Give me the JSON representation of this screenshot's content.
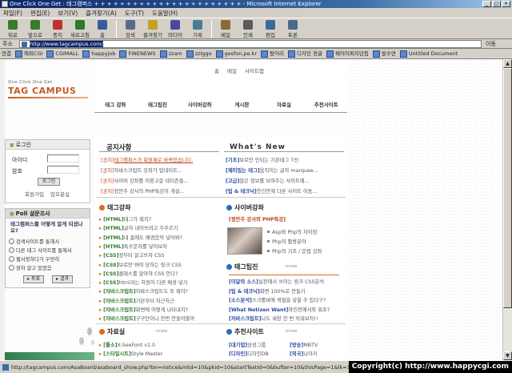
{
  "window": {
    "title": "One Click One Get : 태그캠퍼스 + + + + + + + + + + + + + + + + + + + + + + + - Microsoft Internet Explorer"
  },
  "menu": [
    "파일(F)",
    "편집(E)",
    "보기(V)",
    "즐겨찾기(A)",
    "도구(T)",
    "도움말(H)"
  ],
  "toolbar": [
    {
      "label": "뒤로",
      "icon": "back-arrow-icon",
      "color": "#3a7a2a"
    },
    {
      "label": "앞으로",
      "icon": "forward-arrow-icon",
      "color": "#3a7a2a"
    },
    {
      "label": "중지",
      "icon": "stop-icon",
      "color": "#c03030"
    },
    {
      "label": "새로고침",
      "icon": "refresh-icon",
      "color": "#2a7a2a"
    },
    {
      "label": "홈",
      "icon": "home-icon",
      "color": "#3a5aa0"
    },
    {
      "label": "검색",
      "icon": "search-icon",
      "color": "#5a6a8a"
    },
    {
      "label": "즐겨찾기",
      "icon": "favorites-icon",
      "color": "#c8a020"
    },
    {
      "label": "미디어",
      "icon": "media-icon",
      "color": "#4a4a9a"
    },
    {
      "label": "기록",
      "icon": "history-icon",
      "color": "#4a7a9a"
    },
    {
      "label": "메일",
      "icon": "mail-icon",
      "color": "#8a6a3a"
    },
    {
      "label": "인쇄",
      "icon": "print-icon",
      "color": "#5a5a5a"
    },
    {
      "label": "편집",
      "icon": "edit-icon",
      "color": "#3a6a9a"
    },
    {
      "label": "토론",
      "icon": "discuss-icon",
      "color": "#4a6a8a"
    }
  ],
  "address": {
    "label": "주소(D)",
    "url": "http://www.tagcampus.com/",
    "go": "이동"
  },
  "links": {
    "label": "연결",
    "items": [
      "해피CGI",
      "CGIMALL",
      "happyjob",
      "FINENEWS",
      "zzam",
      "zzlggo",
      "gesfon,pe.kr",
      "탐어리",
      "디자인 정글",
      "쉐어어퍼지던킴",
      "원수연",
      "Untitled Document"
    ]
  },
  "site": {
    "logo_small": "One Click One Get",
    "logo": "TAG CAMPUS",
    "toplinks": [
      "홈",
      "메일",
      "사이트맵"
    ],
    "nav": [
      "태그 강좌",
      "태그팁진",
      "사이버강좌",
      "게시판",
      "자료실",
      "추천사이트"
    ]
  },
  "login": {
    "title": "로그인",
    "id_label": "아이디",
    "pw_label": "암호",
    "login_btn": "로그인",
    "join": "회원가입",
    "find_pw": "암호분실"
  },
  "poll": {
    "title": "Poll 설문조사",
    "question": "태그캠퍼스를 어떻게 알게 되셨나요?",
    "options": [
      "검색사이트를 통해서",
      "다른 태그 사이트를 통해서",
      "웹서핑하다가 우연히",
      "원하 알고 있었음"
    ],
    "vote": "투표",
    "result": "결과"
  },
  "notice": {
    "title": "공지사항",
    "items": [
      {
        "tag": "[공지]",
        "text": "태그캠퍼스가 회원제로 바뀌었습니다.",
        "hl": true
      },
      {
        "tag": "[공지]",
        "text": "자바스크립트 강좌가 업데이트..."
      },
      {
        "tag": "[공지]",
        "text": "사이버 강좌를 이용고갈 네티즌들..."
      },
      {
        "tag": "[공지]",
        "text": "정안주 강사의 PHP특강이 개설..."
      }
    ]
  },
  "whatsnew": {
    "title": "What's New",
    "items": [
      {
        "tag": "[기초]",
        "text": "보로만 인되는 기본태그 7선"
      },
      {
        "tag": "[재미있는 태그]",
        "text": "움직이는 글자 marquee..."
      },
      {
        "tag": "[고급]",
        "text": "많은 정보를 보여주는 사이트에..."
      },
      {
        "tag": "[팁 & 테크닉]",
        "text": "웃긴만해 다른 사이트 이동..."
      }
    ]
  },
  "tag_lecture": {
    "title": "태그강좌",
    "items": [
      {
        "tag": "[HTML]",
        "text": "태그가 뭐지?"
      },
      {
        "tag": "[HTML]",
        "text": "글자 내어쓰려고 주무르기"
      },
      {
        "tag": "[HTML]",
        "text": "내 홈에도 배경음악 넣어봐?"
      },
      {
        "tag": "[HTML]",
        "text": "특수문자를 넣어보자"
      },
      {
        "tag": "[CSS]",
        "text": "정부터 알고쓰자 CSS"
      },
      {
        "tag": "[CSS]",
        "text": "보로만 봐야 당하는 링크 CSS"
      },
      {
        "tag": "[CSS]",
        "text": "클래스를 알아야 CSS 안다?"
      },
      {
        "tag": "[CSS]",
        "text": "html과는 차원이 다른 배경 넣기"
      },
      {
        "tag": "[자바스크립트]",
        "text": "자바스크립트도 또 뭐야?"
      },
      {
        "tag": "[자바스크립트]",
        "text": "기본부터 차근차근"
      },
      {
        "tag": "[자바스크립트]",
        "text": "화면에 어떻게 나타내지?"
      },
      {
        "tag": "[자바스크립트]",
        "text": "구구단이나 한번 만들어볼까"
      }
    ]
  },
  "cyber": {
    "title": "사이버강좌",
    "headline": "[정안주 강사의 PHP특강]",
    "items": [
      "Asp와 Php의 차이점",
      "Php의 활용분야",
      "Php의 기초 / 문법 강좌"
    ]
  },
  "tagtip": {
    "title": "태그팁진",
    "more": "more",
    "items": [
      {
        "tag": "[이달의 소스]",
        "text": "실전에서 쓰이는 링크 CSS분석"
      },
      {
        "tag": "[팁 & 테크닉]",
        "text": "화면 100%로 만들기"
      },
      {
        "tag": "[소스분석]",
        "text": "스크롤바에 색칠을 넣을 수 있다구?"
      },
      {
        "tag": "[What Netizen Want]",
        "text": "마인전에서와 워죠?"
      },
      {
        "tag": "[자바스크립트]",
        "text": "나도 새창 한 번 띄워보자!!"
      }
    ]
  },
  "pds": {
    "title": "자료실",
    "more": "more",
    "items": [
      {
        "tag": "[툴소]",
        "text": "X-SeeFont v1.0"
      },
      {
        "tag": "[스타일시트]",
        "text": "Style Master"
      },
      {
        "tag": "[웹에디터]",
        "text": "ColorWish"
      }
    ]
  },
  "recommend": {
    "title": "추천사이트",
    "more": "more",
    "items": [
      {
        "tag": "[대기업]",
        "text": "삼성그룹"
      },
      {
        "tag": "[디자인]",
        "text": "디자인DB"
      },
      {
        "tag": "[교육]",
        "text": "정보통합"
      }
    ],
    "items2": [
      {
        "tag": "[방송]",
        "text": "MBTV"
      },
      {
        "tag": "[외국]",
        "text": "나이키"
      },
      {
        "tag": "[외국]",
        "text": "고지호"
      }
    ]
  },
  "status": {
    "text": "http://tagcampus.com/AsaBoard/asaboard_show.php?bn=notice&mlid=10&pkid=10&startTextId=0&bufter=10&thisPage=1&lk=1&mode=s"
  },
  "copyright": "Copyright(c) http://www.happycgi.com"
}
